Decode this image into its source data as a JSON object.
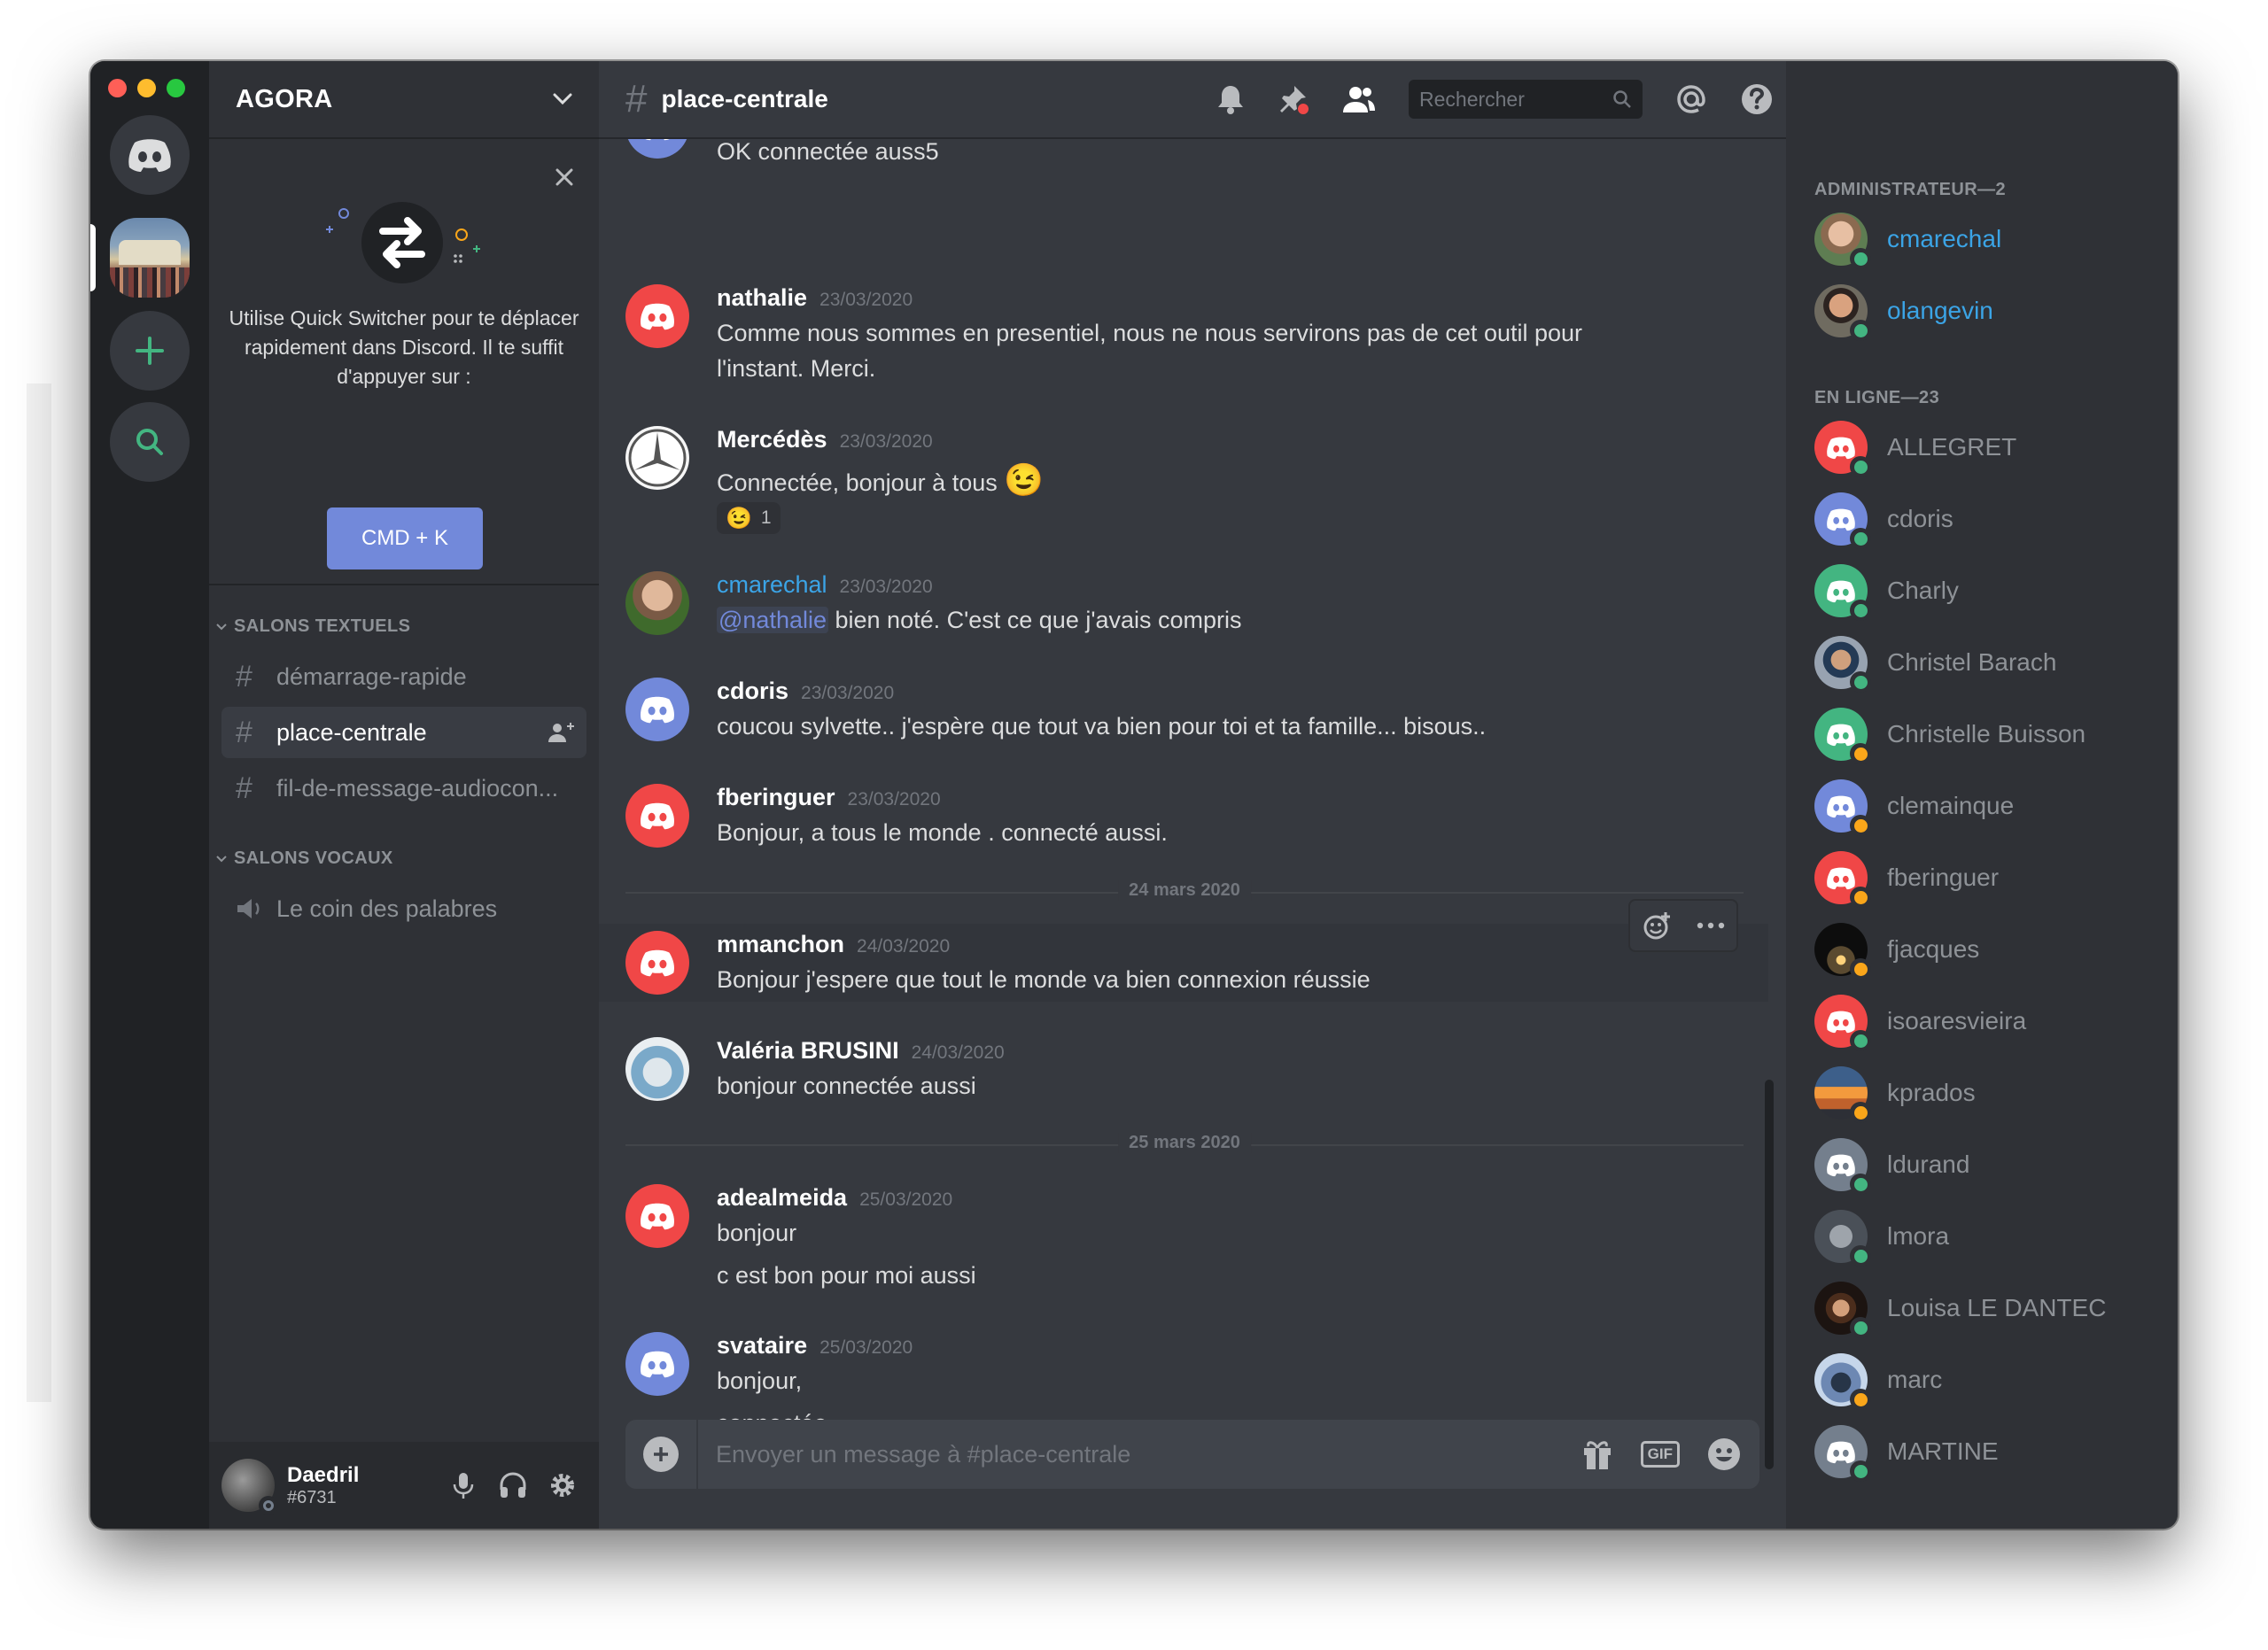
{
  "server": {
    "name": "AGORA"
  },
  "quick_switcher": {
    "text": "Utilise Quick Switcher pour te déplacer rapidement dans Discord. Il te suffit d'appuyer sur :",
    "button_label": "CMD + K"
  },
  "categories": {
    "text": "SALONS TEXTUELS",
    "voice": "SALONS VOCAUX"
  },
  "channels": {
    "text": [
      {
        "name": "démarrage-rapide",
        "active": false
      },
      {
        "name": "place-centrale",
        "active": true
      },
      {
        "name": "fil-de-message-audiocon...",
        "active": false
      }
    ],
    "voice": [
      {
        "name": "Le coin des palabres"
      }
    ]
  },
  "user": {
    "name": "Daedril",
    "tag": "#6731"
  },
  "topbar": {
    "channel_name": "place-centrale",
    "search_placeholder": "Rechercher"
  },
  "messages": [
    {
      "author": "",
      "time": "",
      "lines": [
        "OK connectée auss5"
      ],
      "avatar": "discord",
      "avatar_color": "#7289da"
    },
    {
      "author": "nathalie",
      "time": "23/03/2020",
      "lines": [
        "Comme nous sommes en presentiel, nous ne nous servirons pas de cet outil pour",
        "l'instant. Merci."
      ],
      "avatar": "discord",
      "avatar_color": "#f04747"
    },
    {
      "author": "Mercédès",
      "time": "23/03/2020",
      "lines": [
        "Connectée, bonjour à tous"
      ],
      "emoji": "😉",
      "reaction": {
        "emoji": "😉",
        "count": "1"
      },
      "avatar": "mercedes-logo"
    },
    {
      "author": "cmarechal",
      "time": "23/03/2020",
      "mention": "@nathalie",
      "lines": [
        " bien noté. C'est ce que j'avais compris"
      ],
      "avatar": "photo",
      "author_color": "#3ba4e6"
    },
    {
      "author": "cdoris",
      "time": "23/03/2020",
      "lines": [
        "coucou sylvette.. j'espère que tout va bien pour toi et ta famille... bisous.."
      ],
      "avatar": "discord",
      "avatar_color": "#7289da"
    },
    {
      "author": "fberinguer",
      "time": "23/03/2020",
      "lines": [
        "Bonjour, a tous le monde . connecté aussi."
      ],
      "avatar": "discord",
      "avatar_color": "#f04747"
    },
    {
      "author": "mmanchon",
      "time": "24/03/2020",
      "lines": [
        "Bonjour j'espere que tout le monde va bien  connexion réussie"
      ],
      "avatar": "discord",
      "avatar_color": "#f04747"
    },
    {
      "author": "Valéria BRUSINI",
      "time": "24/03/2020",
      "lines": [
        "bonjour connectée aussi"
      ],
      "avatar": "photo"
    },
    {
      "author": "adealmeida",
      "time": "25/03/2020",
      "lines": [
        "bonjour",
        "c est bon pour moi aussi"
      ],
      "avatar": "discord",
      "avatar_color": "#f04747"
    },
    {
      "author": "svataire",
      "time": "25/03/2020",
      "lines": [
        "bonjour,",
        "connectée"
      ],
      "avatar": "discord",
      "avatar_color": "#7289da"
    }
  ],
  "dividers": [
    "24 mars 2020",
    "25 mars 2020"
  ],
  "composer": {
    "placeholder": "Envoyer un message à #place-centrale",
    "gif_label": "GIF"
  },
  "members": {
    "admin_title": "ADMINISTRATEUR—2",
    "online_title": "EN LIGNE—23",
    "admins": [
      {
        "name": "cmarechal",
        "status": "online"
      },
      {
        "name": "olangevin",
        "status": "online"
      }
    ],
    "online": [
      {
        "name": "ALLEGRET",
        "avatar_color": "#f04747",
        "status": "online"
      },
      {
        "name": "cdoris",
        "avatar_color": "#7289da",
        "status": "online"
      },
      {
        "name": "Charly",
        "avatar_color": "#43b581",
        "status": "online"
      },
      {
        "name": "Christel Barach",
        "avatar": "photo",
        "status": "online"
      },
      {
        "name": "Christelle Buisson",
        "avatar_color": "#43b581",
        "status": "idle"
      },
      {
        "name": "clemainque",
        "avatar_color": "#7289da",
        "status": "idle"
      },
      {
        "name": "fberinguer",
        "avatar_color": "#f04747",
        "status": "idle"
      },
      {
        "name": "fjacques",
        "avatar": "photo",
        "status": "idle"
      },
      {
        "name": "isoaresvieira",
        "avatar_color": "#f04747",
        "status": "online"
      },
      {
        "name": "kprados",
        "avatar": "photo",
        "status": "idle"
      },
      {
        "name": "ldurand",
        "avatar_color": "#747f8d",
        "status": "online"
      },
      {
        "name": "lmora",
        "avatar": "photo",
        "status": "online"
      },
      {
        "name": "Louisa LE DANTEC",
        "avatar": "photo",
        "status": "online"
      },
      {
        "name": "marc",
        "avatar": "photo",
        "status": "idle"
      },
      {
        "name": "MARTINE",
        "avatar_color": "#747f8d",
        "status": "online"
      }
    ]
  },
  "colors": {
    "blurple": "#7289da",
    "red": "#f04747",
    "green": "#43b581",
    "idle": "#faa61a",
    "grey": "#747f8d",
    "admin": "#3ba4e6"
  }
}
